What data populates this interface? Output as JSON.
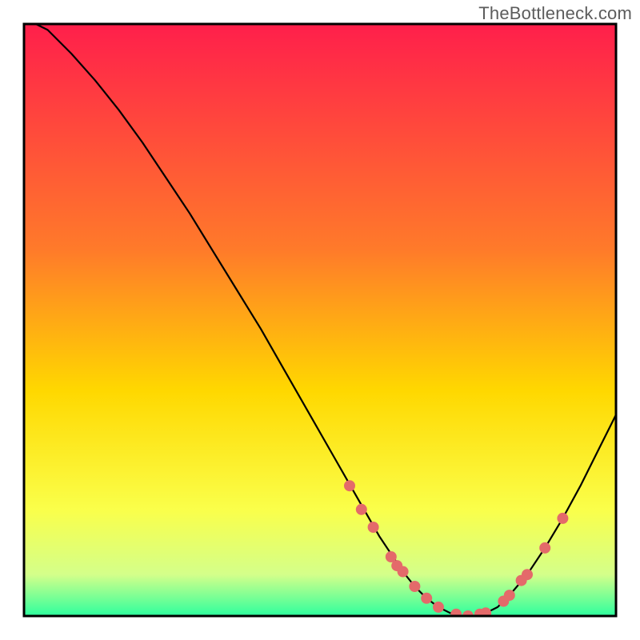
{
  "watermark": "TheBottleneck.com",
  "colors": {
    "gradient_top": "#ff1f4b",
    "gradient_mid1": "#ff7a2a",
    "gradient_mid2": "#ffd800",
    "gradient_mid3": "#faff4a",
    "gradient_bottom1": "#d4ff8a",
    "gradient_bottom2": "#2eff9e",
    "curve": "#000000",
    "markers": "#e46a6a",
    "frame": "#000000",
    "background": "#ffffff"
  },
  "chart_data": {
    "type": "line",
    "title": "",
    "xlabel": "",
    "ylabel": "",
    "xlim": [
      0,
      100
    ],
    "ylim": [
      0,
      100
    ],
    "grid": false,
    "legend": false,
    "annotations": [],
    "x": [
      2,
      4,
      8,
      12,
      16,
      20,
      24,
      28,
      32,
      36,
      40,
      44,
      48,
      52,
      56,
      58,
      60,
      62,
      64,
      66,
      68,
      70,
      72,
      74,
      76,
      78,
      80,
      82,
      85,
      88,
      91,
      94,
      97,
      100
    ],
    "values": [
      100,
      99,
      95,
      90.5,
      85.5,
      80,
      74,
      68,
      61.5,
      55,
      48.5,
      41.5,
      34.5,
      27.5,
      20.5,
      17,
      13.5,
      10.5,
      7.5,
      5,
      3,
      1.5,
      0.5,
      0,
      0,
      0.5,
      1.5,
      3.5,
      7,
      11.5,
      16.5,
      22,
      28,
      34
    ],
    "markers": [
      {
        "x": 55,
        "y": 22
      },
      {
        "x": 57,
        "y": 18
      },
      {
        "x": 59,
        "y": 15
      },
      {
        "x": 62,
        "y": 10
      },
      {
        "x": 63,
        "y": 8.5
      },
      {
        "x": 64,
        "y": 7.5
      },
      {
        "x": 66,
        "y": 5
      },
      {
        "x": 68,
        "y": 3
      },
      {
        "x": 70,
        "y": 1.5
      },
      {
        "x": 73,
        "y": 0.3
      },
      {
        "x": 75,
        "y": 0
      },
      {
        "x": 77,
        "y": 0.3
      },
      {
        "x": 78,
        "y": 0.5
      },
      {
        "x": 81,
        "y": 2.5
      },
      {
        "x": 82,
        "y": 3.5
      },
      {
        "x": 84,
        "y": 6
      },
      {
        "x": 85,
        "y": 7
      },
      {
        "x": 88,
        "y": 11.5
      },
      {
        "x": 91,
        "y": 16.5
      }
    ]
  }
}
